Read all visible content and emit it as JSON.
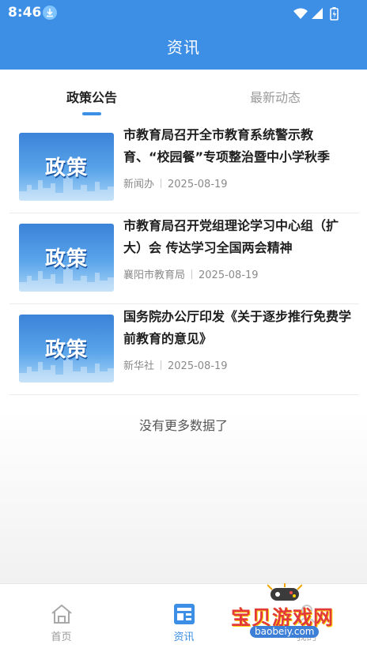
{
  "status_bar": {
    "time": "8:46"
  },
  "header": {
    "title": "资讯"
  },
  "tabs": [
    {
      "label": "政策公告",
      "active": true
    },
    {
      "label": "最新动态",
      "active": false
    }
  ],
  "news": [
    {
      "thumb_text": "政策",
      "title": "市教育局召开全市教育系统警示教育、“校园餐”专项整治暨中小学秋季开…",
      "source": "新闻办",
      "date": "2025-08-19"
    },
    {
      "thumb_text": "政策",
      "title": "市教育局召开党组理论学习中心组（扩大）会 传达学习全国两会精神",
      "source": "襄阳市教育局",
      "date": "2025-08-19"
    },
    {
      "thumb_text": "政策",
      "title": "国务院办公厅印发《关于逐步推行免费学前教育的意见》",
      "source": "新华社",
      "date": "2025-08-19"
    }
  ],
  "no_more_text": "没有更多数据了",
  "bottom_nav": [
    {
      "label": "首页",
      "icon": "home-icon",
      "active": false
    },
    {
      "label": "资讯",
      "icon": "news-icon",
      "active": true
    },
    {
      "label": "我的",
      "icon": "user-icon",
      "active": false
    }
  ],
  "watermark": {
    "text": "宝贝游戏网",
    "url": "baobeiy.com"
  },
  "colors": {
    "primary": "#3d8fe6",
    "tab_inactive": "#9a9a9a",
    "title_text": "#1e1e1e",
    "meta_text": "#8a8a8a"
  }
}
